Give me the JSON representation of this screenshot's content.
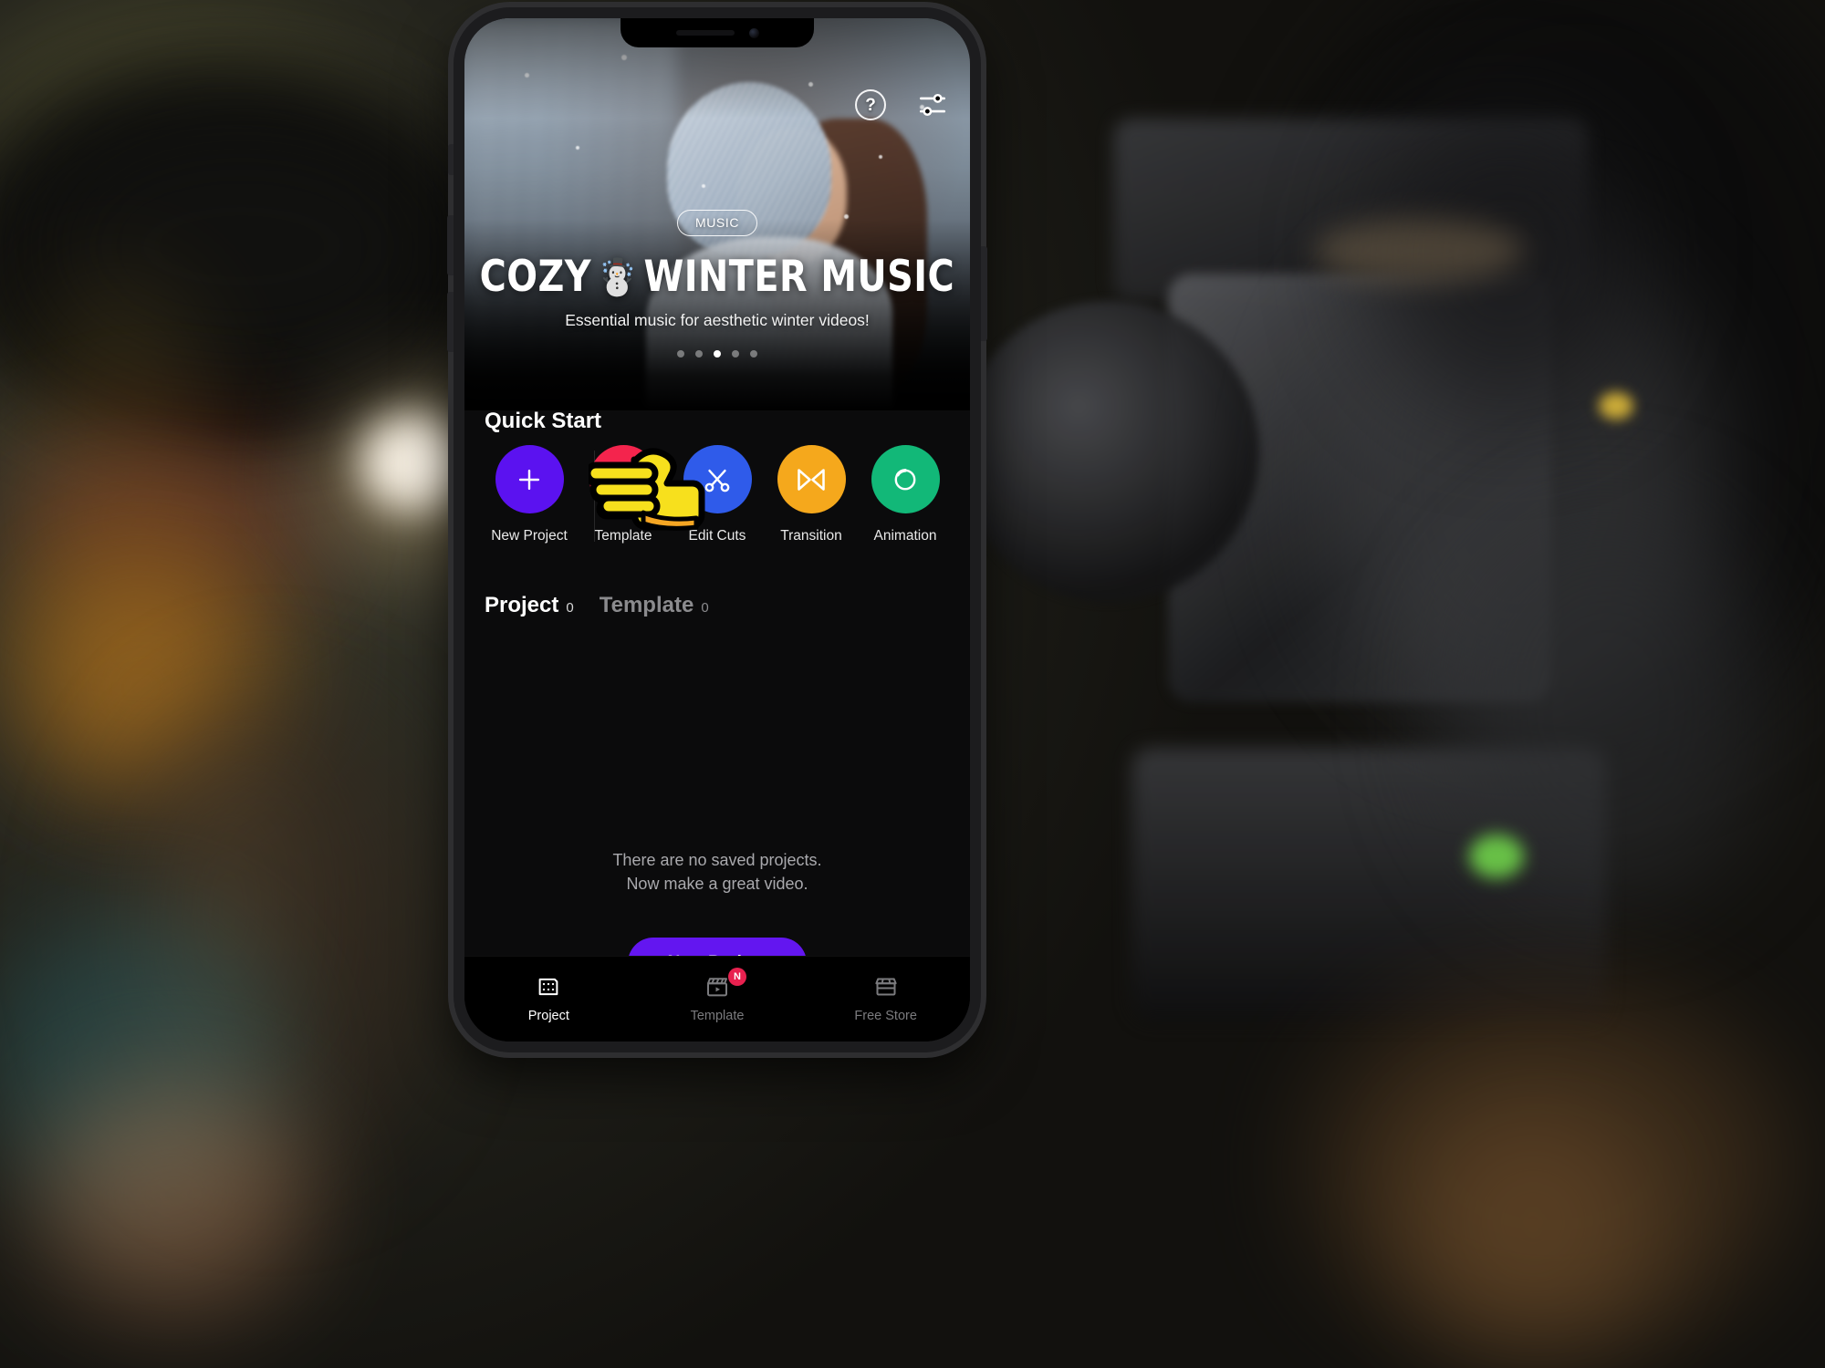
{
  "banner": {
    "badge": "MUSIC",
    "title_part1": "COZY",
    "title_emoji": "☃️",
    "title_part2": "WINTER MUSIC",
    "subtitle": "Essential music for aesthetic winter videos!",
    "help_glyph": "?",
    "dots_count": 5,
    "active_dot_index": 2
  },
  "quick_start": {
    "heading": "Quick Start",
    "items": [
      {
        "label": "New Project",
        "icon": "plus-icon",
        "color": "#5b12f0"
      },
      {
        "label": "Template",
        "icon": "template-icon",
        "color": "#f4244d"
      },
      {
        "label": "Edit Cuts",
        "icon": "scissors-icon",
        "color": "#2f5bea"
      },
      {
        "label": "Transition",
        "icon": "transition-icon",
        "color": "#f5a81c"
      },
      {
        "label": "Animation",
        "icon": "animation-icon",
        "color": "#12b878"
      }
    ]
  },
  "list_tabs": [
    {
      "label": "Project",
      "count": "0",
      "active": true
    },
    {
      "label": "Template",
      "count": "0",
      "active": false
    }
  ],
  "empty_state": {
    "line1": "There are no saved projects.",
    "line2": "Now make a great video.",
    "cta_label": "New Project"
  },
  "tabbar": [
    {
      "label": "Project",
      "icon": "filmstrip-icon",
      "active": true,
      "badge": ""
    },
    {
      "label": "Template",
      "icon": "clapperboard-icon",
      "active": false,
      "badge": "N"
    },
    {
      "label": "Free Store",
      "icon": "store-icon",
      "active": false,
      "badge": ""
    }
  ],
  "colors": {
    "accent_purple": "#6316f0",
    "badge_red": "#e8214f",
    "screen_bg": "#0b0b0c"
  }
}
